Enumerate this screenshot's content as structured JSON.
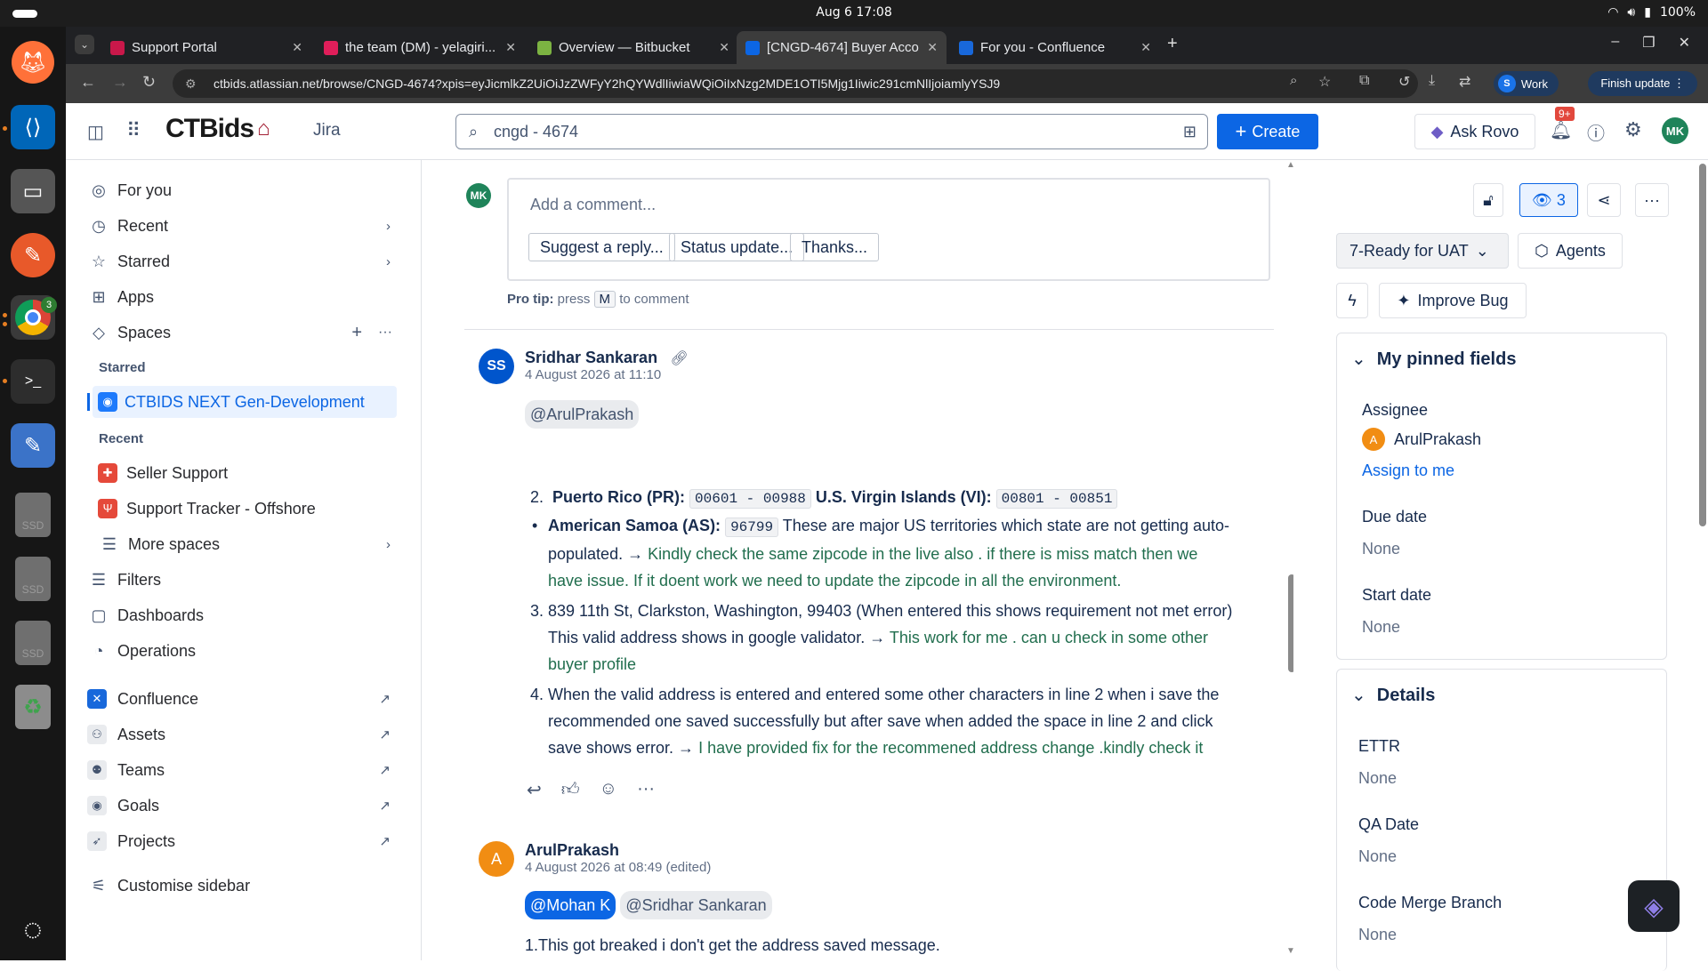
{
  "system": {
    "clock": "Aug 6  17:08",
    "battery": "100%"
  },
  "dock": {
    "chrome_badge": "3",
    "ssd_labels": [
      "SSD",
      "SSD",
      "SSD"
    ]
  },
  "browser": {
    "tabs": [
      {
        "title": "Support Portal",
        "color": "#c9184a"
      },
      {
        "title": "the team (DM) - yelagiri...",
        "color": "#e01e5a"
      },
      {
        "title": "Overview — Bitbucket",
        "color": "#7cb342"
      },
      {
        "title": "[CNGD-4674] Buyer Acco...",
        "color": "#0c66e4"
      },
      {
        "title": "For you - Confluence",
        "color": "#1868db"
      }
    ],
    "url": "ctbids.atlassian.net/browse/CNGD-4674?xpis=eyJicmlkZ2UiOiJzZWFyY2hQYWdlIiwiaWQiOiIxNzg2MDE1OTI5Mjg1Iiwic291cmNlIjoiamlyYSJ9",
    "profile_label": "Work",
    "profile_initial": "S",
    "finish_update": "Finish update"
  },
  "header": {
    "brand": "CTBids",
    "product": "Jira",
    "search_value": "cngd - 4674",
    "create_label": "Create",
    "ask_rovo": "Ask Rovo",
    "notif_badge": "9+",
    "user_initials": "MK"
  },
  "sidebar": {
    "items": [
      {
        "label": "For you",
        "icon": "◎"
      },
      {
        "label": "Recent",
        "icon": "◷"
      },
      {
        "label": "Starred",
        "icon": "☆"
      },
      {
        "label": "Apps",
        "icon": "⊞"
      },
      {
        "label": "Spaces",
        "icon": "◇"
      }
    ],
    "starred_heading": "Starred",
    "starred_space": "CTBIDS NEXT Gen-Development",
    "recent_heading": "Recent",
    "recent_spaces": [
      "Seller Support",
      "Support Tracker - Offshore"
    ],
    "more_spaces": "More spaces",
    "lower": [
      "Filters",
      "Dashboards",
      "Operations"
    ],
    "apps": [
      "Confluence",
      "Assets",
      "Teams",
      "Goals",
      "Projects"
    ],
    "customise": "Customise sidebar"
  },
  "comment_box": {
    "avatar": "MK",
    "placeholder": "Add a comment...",
    "suggestions": [
      "Suggest a reply...",
      "Status update...",
      "Thanks..."
    ],
    "protip_label": "Pro tip:",
    "protip_pre": "press",
    "protip_key": "M",
    "protip_post": "to comment"
  },
  "comment1": {
    "avatar": "SS",
    "author": "Sridhar Sankaran",
    "date": "4 August 2026 at 11:10",
    "mention": "@ArulPrakash",
    "item2_num": "2.",
    "pr_label": "Puerto Rico (PR):",
    "pr_code": "00601 - 00988",
    "vi_label": "U.S. Virgin Islands (VI):",
    "vi_code": "00801 - 00851",
    "as_label": "American Samoa (AS):",
    "as_code": "96799",
    "as_text_1": "These are major US territories which state are not getting auto-",
    "as_text_2": "populated. →",
    "as_reply_1": "Kindly check the same zipcode in the live also . if there is miss match then we",
    "as_reply_2": "have issue. If it doent work we need to update the zipcode in all the environment.",
    "item3_num": "3.",
    "item3_line1": "839 11th St, Clarkston, Washington, 99403 (When entered this shows requirement not met error)",
    "item3_line2": "This valid address shows in google validator. →",
    "item3_reply_1": "This work for me . can u check in some other",
    "item3_reply_2": "buyer profile",
    "item4_num": "4.",
    "item4_line1": "When the valid address is entered and entered some other characters in line 2 when i save the",
    "item4_line2": "recommended one saved successfully but after save when added the space in line 2 and click",
    "item4_line3": "save shows error. →",
    "item4_reply": "I have provided fix for the recommened address change .kindly check it"
  },
  "comment2": {
    "avatar": "A",
    "author": "ArulPrakash",
    "date": "4 August 2026 at 08:49 (edited)",
    "mention1": "@Mohan K",
    "mention2": "@Sridhar Sankaran",
    "text": "1.This got breaked i don't get the address saved message."
  },
  "details": {
    "watch_count": "3",
    "status": "7-Ready for UAT",
    "agents": "Agents",
    "improve": "Improve Bug",
    "pinned_title": "My pinned fields",
    "assignee_label": "Assignee",
    "assignee_initial": "A",
    "assignee_name": "ArulPrakash",
    "assign_to_me": "Assign to me",
    "due_label": "Due date",
    "due_value": "None",
    "start_label": "Start date",
    "start_value": "None",
    "details_title": "Details",
    "ettr_label": "ETTR",
    "ettr_value": "None",
    "qa_label": "QA Date",
    "qa_value": "None",
    "cmb_label": "Code Merge Branch",
    "cmb_value": "None"
  }
}
